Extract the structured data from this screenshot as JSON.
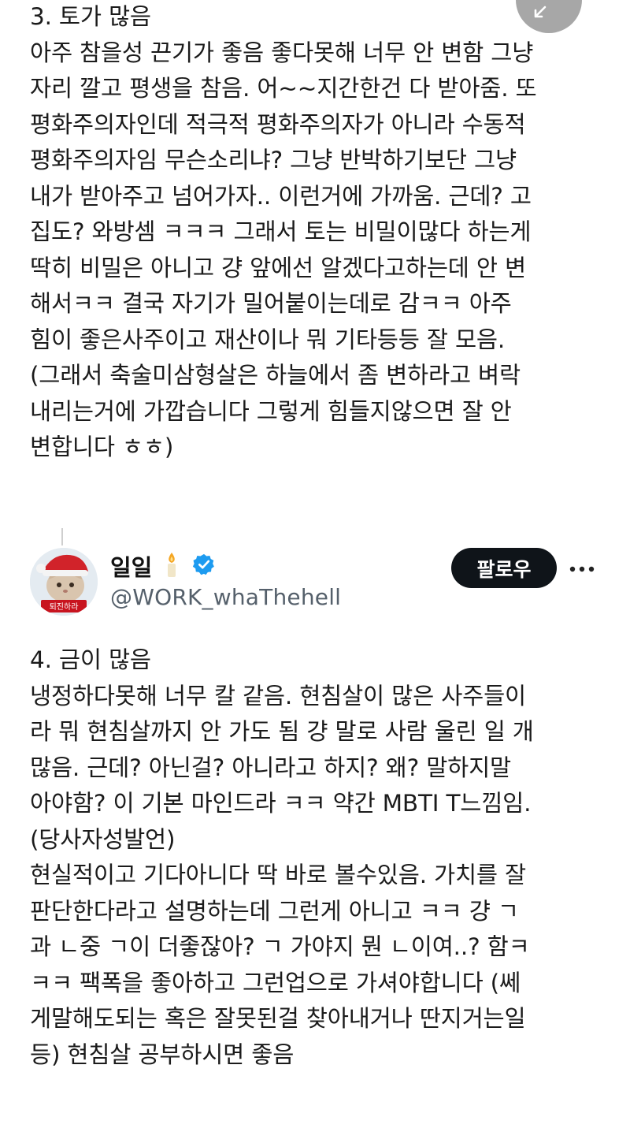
{
  "section3": {
    "lines": [
      "3. 토가 많음",
      "아주 참을성 끈기가 좋음 좋다못해 너무 안 변함 그냥",
      "자리 깔고 평생을 참음. 어~~지간한건 다 받아줌. 또",
      "평화주의자인데 적극적 평화주의자가 아니라 수동적",
      "평화주의자임 무슨소리냐? 그냥 반박하기보단 그냥",
      "내가 받아주고 넘어가자.. 이런거에 가까움. 근데? 고",
      "집도? 와방셈 ㅋㅋㅋ 그래서 토는 비밀이많다 하는게",
      "딱히 비밀은 아니고 걍 앞에선 알겠다고하는데 안 변",
      "해서ㅋㅋ 결국 자기가 밀어붙이는데로 감ㅋㅋ 아주",
      "힘이 좋은사주이고 재산이나 뭐 기타등등 잘 모음.",
      "(그래서 축술미삼형살은 하늘에서 좀 변하라고 벼락",
      "내리는거에 가깝습니다 그렇게 힘들지않으면 잘 안",
      "변합니다 ㅎㅎ)"
    ]
  },
  "profile": {
    "display_name": "일일",
    "handle": "@WORK_whaThehell",
    "follow_label": "팔로우",
    "avatar_text": "퇴진하라"
  },
  "section4": {
    "lines": [
      "4. 금이 많음",
      "냉정하다못해 너무 칼 같음. 현침살이 많은 사주들이",
      "라 뭐 현침살까지 안 가도 됨 걍 말로 사람 울린 일 개",
      "많음. 근데? 아닌걸? 아니라고 하지? 왜? 말하지말",
      "아야함? 이 기본 마인드라 ㅋㅋ 약간 MBTI T느낌임.",
      "(당사자성발언)",
      "현실적이고 기다아니다 딱 바로 볼수있음. 가치를 잘",
      "판단한다라고 설명하는데 그런게 아니고 ㅋㅋ 걍 ㄱ",
      "과 ㄴ중 ㄱ이 더좋잖아? ㄱ 가야지 뭔 ㄴ이여..? 함ㅋ",
      "ㅋㅋ 팩폭을 좋아하고 그런업으로 가셔야합니다 (쎄",
      "게말해도되는 혹은 잘못된걸 찾아내거나 딴지거는일",
      "등) 현침살 공부하시면 좋음"
    ]
  },
  "icons": {
    "corner": "collapse-arrow-icon",
    "candle": "candle-icon",
    "verified": "verified-badge-icon",
    "more": "more-options-icon"
  },
  "colors": {
    "verified": "#1d9bf0",
    "follow_bg": "#0f1419",
    "handle": "#55606b"
  }
}
